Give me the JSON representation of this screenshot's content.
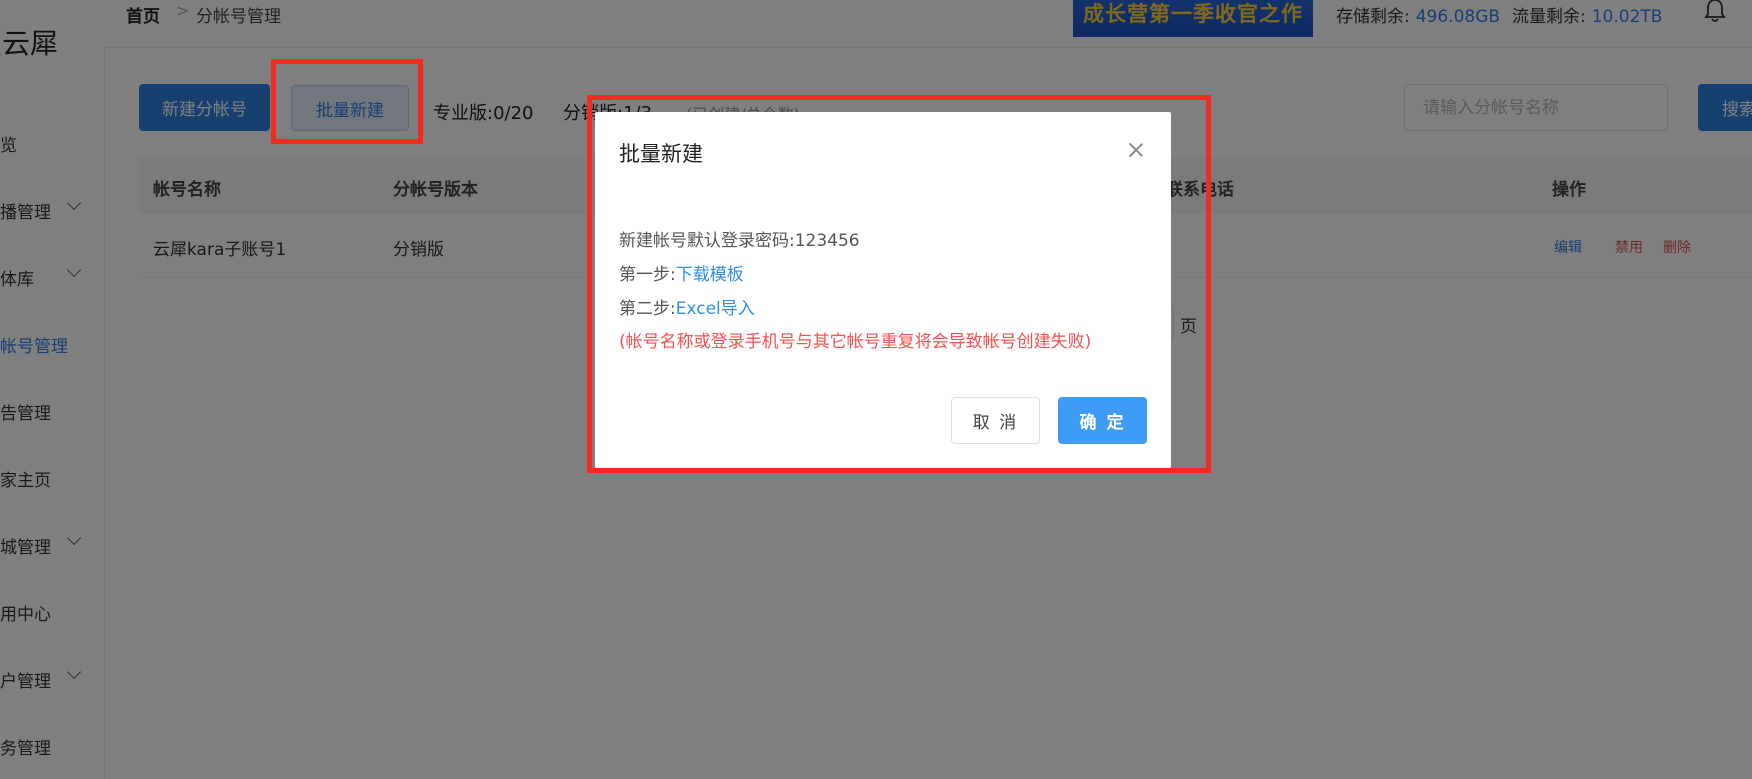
{
  "sidebar": {
    "logo": "星云犀",
    "items": [
      {
        "label": "概览",
        "has_submenu": false,
        "active": false
      },
      {
        "label": "直播管理",
        "has_submenu": true,
        "active": false
      },
      {
        "label": "媒体库",
        "has_submenu": true,
        "active": false
      },
      {
        "label": "分帐号管理",
        "has_submenu": false,
        "active": true
      },
      {
        "label": "广告管理",
        "has_submenu": false,
        "active": false
      },
      {
        "label": "商家主页",
        "has_submenu": false,
        "active": false
      },
      {
        "label": "商城管理",
        "has_submenu": true,
        "active": false
      },
      {
        "label": "应用中心",
        "has_submenu": false,
        "active": false
      },
      {
        "label": "用户管理",
        "has_submenu": true,
        "active": false
      },
      {
        "label": "财务管理",
        "has_submenu": false,
        "active": false
      }
    ]
  },
  "header": {
    "breadcrumb_home": "首页",
    "breadcrumb_sep": ">",
    "breadcrumb_current": "分帐号管理",
    "banner_text": "成长营第一季收官之作",
    "storage_label": "存储剩余:",
    "storage_value": "496.08GB",
    "traffic_label": "流量剩余:",
    "traffic_value": "10.02TB",
    "bell_icon": "bell-icon"
  },
  "toolbar": {
    "new_label": "新建分帐号",
    "batch_label": "批量新建",
    "pro_count": "专业版:0/20",
    "dist_count": "分销版:1/3",
    "count_hint": "(已创建/总个数)",
    "search_placeholder": "请输入分帐号名称",
    "search_value": "",
    "search_label": "搜索"
  },
  "table": {
    "columns": [
      "帐号名称",
      "分帐号版本",
      "联系电话",
      "操作"
    ],
    "rows": [
      {
        "name": "云犀kara子账号1",
        "version": "分销版",
        "phone": "",
        "ops": [
          "编辑",
          "禁用",
          "删除"
        ]
      }
    ],
    "pager_page_label": "页"
  },
  "dialog": {
    "title": "批量新建",
    "default_password_label": "新建帐号默认登录密码:123456",
    "step1_label": "第一步:",
    "step1_link": "下载模板",
    "step2_label": "第二步:",
    "step2_link": "Excel导入",
    "warning": "(帐号名称或登录手机号与其它帐号重复将会导致帐号创建失败)",
    "cancel_label": "取 消",
    "ok_label": "确 定"
  },
  "colors": {
    "primary": "#2f80e0",
    "link": "#2f8ee8",
    "warning": "#f45151",
    "highlight_border": "#f42a1e",
    "danger": "#e05454"
  }
}
